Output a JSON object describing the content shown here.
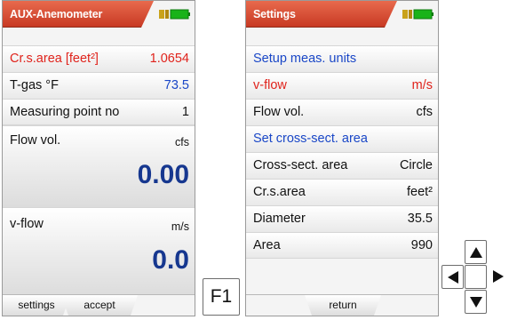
{
  "colors": {
    "titlebar": "#d9472f",
    "red_text": "#e0231c",
    "blue_text": "#1a47c7",
    "value_navy": "#16378f",
    "battery_green": "#19b319"
  },
  "screen1": {
    "title": "AUX-Anemometer",
    "rows": [
      {
        "label": "Cr.s.area [feet²]",
        "value": "1.0654"
      },
      {
        "label": "T-gas °F",
        "value": "73.5"
      },
      {
        "label": "Measuring point no",
        "value": "1"
      }
    ],
    "flow": {
      "label": "Flow vol.",
      "unit": "cfs",
      "value": "0.00"
    },
    "vflow": {
      "label": "v-flow",
      "unit": "m/s",
      "value": "0.0"
    },
    "softkeys": [
      "settings",
      "accept"
    ]
  },
  "screen2": {
    "title": "Settings",
    "rows": [
      {
        "label": "Setup meas. units",
        "value": ""
      },
      {
        "label": "v-flow",
        "value": "m/s"
      },
      {
        "label": "Flow vol.",
        "value": "cfs"
      },
      {
        "label": "Set cross-sect. area",
        "value": ""
      },
      {
        "label": "Cross-sect. area",
        "value": "Circle"
      },
      {
        "label": "Cr.s.area",
        "value": "feet²"
      },
      {
        "label": "Diameter",
        "value": "35.5"
      },
      {
        "label": "Area",
        "value": "990"
      }
    ],
    "softkeys": [
      "return"
    ]
  },
  "f1_key": "F1",
  "dpad": {
    "up": "arrow-up-icon",
    "down": "arrow-down-icon",
    "left": "arrow-left-icon",
    "right": "arrow-right-icon"
  }
}
